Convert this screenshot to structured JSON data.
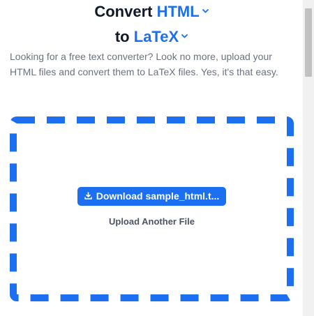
{
  "header": {
    "line1_prefix": "Convert",
    "from_format": "HTML",
    "line2_prefix": "to",
    "to_format": "LaTeX"
  },
  "description": "Looking for a free text converter? Look no more, upload your HTML files and convert them to LaTeX files. Yes, it's that easy.",
  "dropzone": {
    "download_label": "Download sample_html.t...",
    "upload_another_label": "Upload Another File"
  },
  "icons": {
    "format_dropdown": "chevron-down-icon",
    "download": "download-icon"
  },
  "colors": {
    "accent": "#1d6ff2",
    "title_text": "#111827",
    "body_text": "#6b7280",
    "secondary_link": "#4b5563"
  }
}
